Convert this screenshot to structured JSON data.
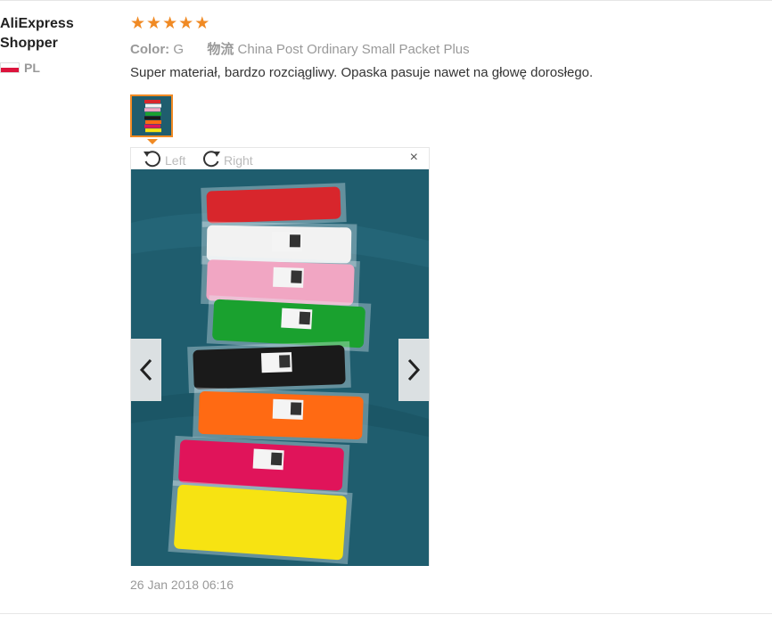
{
  "review": {
    "user_name": "AliExpress\nShopper",
    "country": "PL",
    "rating": 5,
    "color_label": "Color:",
    "color_value": "G",
    "shipping_label": "物流",
    "shipping_value": "China Post Ordinary Small Packet Plus",
    "text": "Super materiał, bardzo rozciągliwy. Opaska pasuje nawet na głowę dorosłego.",
    "date": "26 Jan 2018 06:16"
  },
  "viewer": {
    "rotate_left_label": "Left",
    "rotate_right_label": "Right",
    "close_symbol": "×"
  },
  "photo": {
    "background": "#1f5d6e",
    "headbands": [
      "#d8262c",
      "#f2f2f2",
      "#f1a6c3",
      "#1aa12f",
      "#1a1a1a",
      "#ff6a13",
      "#e0145a",
      "#f7e312"
    ]
  },
  "icons": [
    "star-icon",
    "rotate-left-icon",
    "rotate-right-icon",
    "close-icon",
    "chevron-left-icon",
    "chevron-right-icon"
  ],
  "colors": {
    "accent": "#f08a24",
    "muted_text": "#999999"
  }
}
